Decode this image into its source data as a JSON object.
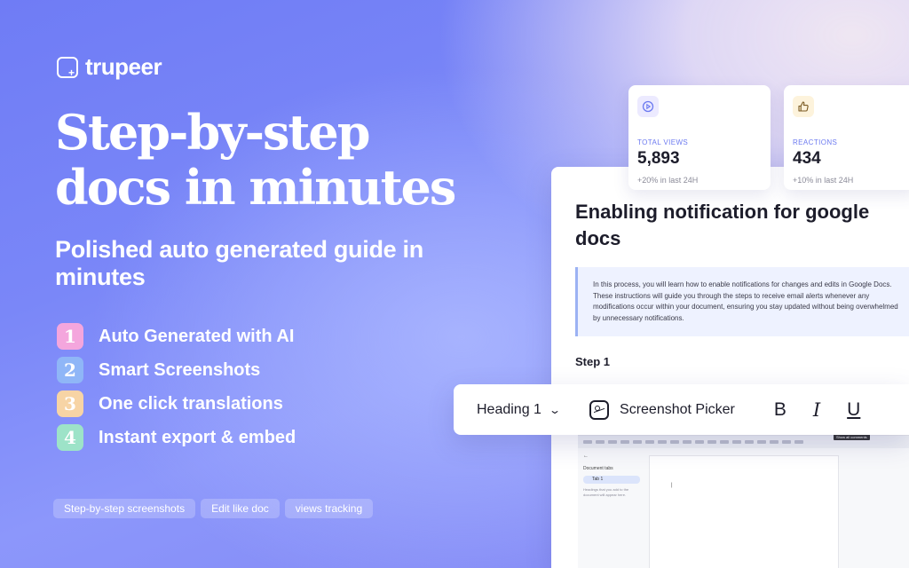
{
  "brand": {
    "name": "trupeer"
  },
  "hero": {
    "headline": "Step-by-step docs in minutes",
    "subhead": "Polished auto generated guide in minutes"
  },
  "features": [
    {
      "num": "1",
      "label": "Auto Generated with AI",
      "color": "#f4a6dd"
    },
    {
      "num": "2",
      "label": "Smart Screenshots",
      "color": "#8fb6f7"
    },
    {
      "num": "3",
      "label": "One click translations",
      "color": "#f7d4a5"
    },
    {
      "num": "4",
      "label": "Instant export & embed",
      "color": "#9de3c8"
    }
  ],
  "tags": [
    "Step-by-step screenshots",
    "Edit like doc",
    "views tracking"
  ],
  "stats": [
    {
      "icon": "play-circle-icon",
      "label": "TOTAL VIEWS",
      "value": "5,893",
      "sub": "+20% in last 24H",
      "label_color": "#6c7af0",
      "icon_bg": "#eceaff"
    },
    {
      "icon": "thumbs-up-icon",
      "label": "REACTIONS",
      "value": "434",
      "sub": "+10% in last 24H",
      "label_color": "#6c7af0",
      "icon_bg": "#fdf3dc"
    }
  ],
  "doc": {
    "title": "Enabling notification for google docs",
    "intro": "In this process, you will learn how to enable notifications for changes and edits in Google Docs. These instructions will guide you through the steps to receive email alerts whenever any modifications occur within your document, ensuring you stay updated without being overwhelmed by unnecessary notifications.",
    "step": "Step 1",
    "screenshot": {
      "tooltip": "Show all comments",
      "sidebar_title": "Document tabs",
      "tab": "Tab 1",
      "hint": "Headings that you add to the document will appear here."
    }
  },
  "toolbar": {
    "heading": "Heading 1",
    "picker": "Screenshot Picker",
    "bold": "B",
    "italic": "I",
    "underline": "U"
  }
}
